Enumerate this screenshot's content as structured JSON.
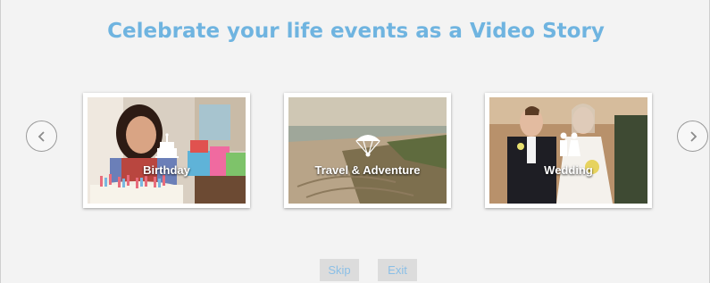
{
  "page": {
    "title": "Celebrate your life events as a Video Story"
  },
  "nav": {
    "prev_icon": "chevron-left-icon",
    "next_icon": "chevron-right-icon"
  },
  "cards": [
    {
      "label": "Birthday",
      "icon": "cake-icon"
    },
    {
      "label": "Travel & Adventure",
      "icon": "parachute-icon"
    },
    {
      "label": "Wedding",
      "icon": "couple-icon"
    }
  ],
  "footer": {
    "skip_label": "Skip",
    "exit_label": "Exit"
  },
  "colors": {
    "title": "#6fb4e0",
    "button_text": "#8bbfe6",
    "button_bg": "#dcdcdc",
    "background": "#f3f3f3"
  }
}
